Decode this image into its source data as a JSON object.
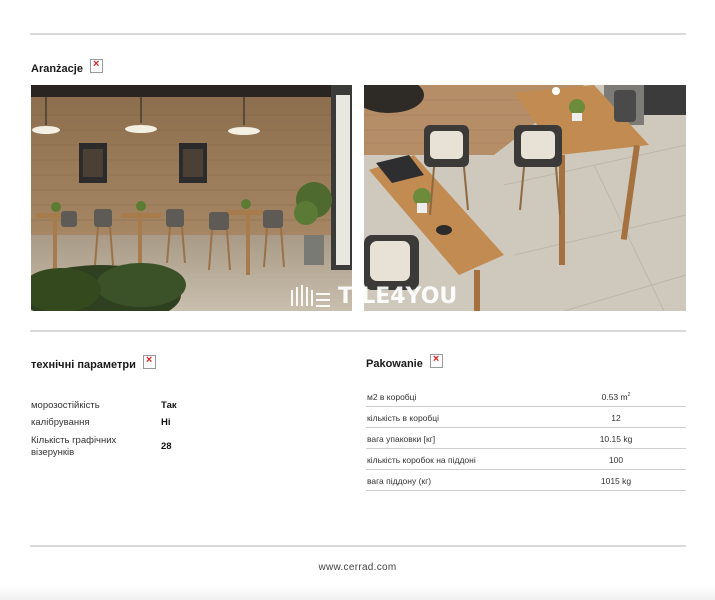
{
  "arrangement": {
    "title": "Aranżacje",
    "image_icon": "broken-image-icon"
  },
  "photos": {
    "left_alt": "cafe-interior-photo",
    "right_alt": "bar-tables-photo",
    "watermark": "TILE4YOU"
  },
  "tech": {
    "title": "технічні параметри",
    "rows": [
      {
        "label": "морозостійкість",
        "value": "Так"
      },
      {
        "label": "калібрування",
        "value": "Hi"
      },
      {
        "label": "Кількість графічних візерунків",
        "value": "28"
      }
    ]
  },
  "packing": {
    "title": "Pakowanie",
    "rows": [
      {
        "label": "м2 в коробці",
        "value": "0.53 m",
        "sup": "2"
      },
      {
        "label": "кількість в коробці",
        "value": "12"
      },
      {
        "label": "вага упаковки [кг]",
        "value": "10.15 kg"
      },
      {
        "label": "кількість коробок на піддоні",
        "value": "100"
      },
      {
        "label": "вага піддону (кг)",
        "value": "1015 kg"
      }
    ]
  },
  "footer": {
    "url": "www.cerrad.com"
  }
}
